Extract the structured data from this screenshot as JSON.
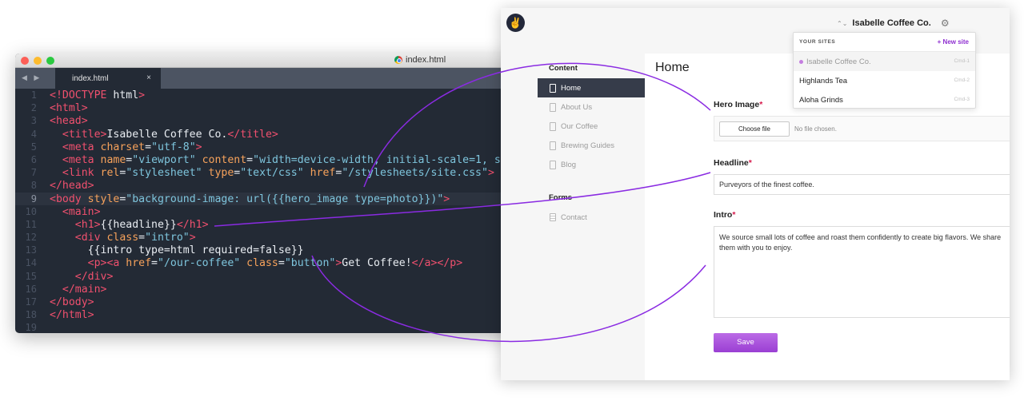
{
  "editor": {
    "window_title": "index.html",
    "tab_label": "index.html",
    "tab_close": "×",
    "nav_arrows": "◀ ▶",
    "lines": [
      {
        "n": "1",
        "segments": [
          {
            "t": "<!DOCTYPE ",
            "c": "tag"
          },
          {
            "t": "html",
            "c": "txt"
          },
          {
            "t": ">",
            "c": "tag"
          }
        ]
      },
      {
        "n": "2",
        "segments": [
          {
            "t": "<html>",
            "c": "tag"
          }
        ]
      },
      {
        "n": "3",
        "segments": [
          {
            "t": "<head>",
            "c": "tag"
          }
        ]
      },
      {
        "n": "4",
        "segments": [
          {
            "t": "  <title>",
            "c": "tag"
          },
          {
            "t": "Isabelle Coffee Co.",
            "c": "txt"
          },
          {
            "t": "</title>",
            "c": "tag"
          }
        ]
      },
      {
        "n": "5",
        "segments": [
          {
            "t": "  <meta ",
            "c": "tag"
          },
          {
            "t": "charset",
            "c": "attr"
          },
          {
            "t": "=",
            "c": "txt"
          },
          {
            "t": "\"utf-8\"",
            "c": "str"
          },
          {
            "t": ">",
            "c": "tag"
          }
        ]
      },
      {
        "n": "6",
        "segments": [
          {
            "t": "  <meta ",
            "c": "tag"
          },
          {
            "t": "name",
            "c": "attr"
          },
          {
            "t": "=",
            "c": "txt"
          },
          {
            "t": "\"viewport\" ",
            "c": "str"
          },
          {
            "t": "content",
            "c": "attr"
          },
          {
            "t": "=",
            "c": "txt"
          },
          {
            "t": "\"width=device-width, initial-scale=1, s",
            "c": "str"
          }
        ]
      },
      {
        "n": "7",
        "segments": [
          {
            "t": "  <link ",
            "c": "tag"
          },
          {
            "t": "rel",
            "c": "attr"
          },
          {
            "t": "=",
            "c": "txt"
          },
          {
            "t": "\"stylesheet\" ",
            "c": "str"
          },
          {
            "t": "type",
            "c": "attr"
          },
          {
            "t": "=",
            "c": "txt"
          },
          {
            "t": "\"text/css\" ",
            "c": "str"
          },
          {
            "t": "href",
            "c": "attr"
          },
          {
            "t": "=",
            "c": "txt"
          },
          {
            "t": "\"/stylesheets/site.css\"",
            "c": "str"
          },
          {
            "t": ">",
            "c": "tag"
          }
        ]
      },
      {
        "n": "8",
        "segments": [
          {
            "t": "</head>",
            "c": "tag"
          }
        ]
      },
      {
        "n": "9",
        "hl": true,
        "segments": [
          {
            "t": "<body ",
            "c": "tag"
          },
          {
            "t": "style",
            "c": "attr"
          },
          {
            "t": "=",
            "c": "txt"
          },
          {
            "t": "\"background-image: url({{hero_image type=photo}})\"",
            "c": "str"
          },
          {
            "t": ">",
            "c": "tag"
          }
        ]
      },
      {
        "n": "10",
        "segments": [
          {
            "t": "  <main>",
            "c": "tag"
          }
        ]
      },
      {
        "n": "11",
        "segments": [
          {
            "t": "    <h1>",
            "c": "tag"
          },
          {
            "t": "{{headline}}",
            "c": "txt"
          },
          {
            "t": "</h1>",
            "c": "tag"
          }
        ]
      },
      {
        "n": "12",
        "segments": [
          {
            "t": "    <div ",
            "c": "tag"
          },
          {
            "t": "class",
            "c": "attr"
          },
          {
            "t": "=",
            "c": "txt"
          },
          {
            "t": "\"intro\"",
            "c": "str"
          },
          {
            "t": ">",
            "c": "tag"
          }
        ]
      },
      {
        "n": "13",
        "segments": [
          {
            "t": "      {{intro type=html required=false}}",
            "c": "txt"
          }
        ]
      },
      {
        "n": "14",
        "segments": [
          {
            "t": "      <p><a ",
            "c": "tag"
          },
          {
            "t": "href",
            "c": "attr"
          },
          {
            "t": "=",
            "c": "txt"
          },
          {
            "t": "\"/our-coffee\" ",
            "c": "str"
          },
          {
            "t": "class",
            "c": "attr"
          },
          {
            "t": "=",
            "c": "txt"
          },
          {
            "t": "\"button\"",
            "c": "str"
          },
          {
            "t": ">",
            "c": "tag"
          },
          {
            "t": "Get Coffee!",
            "c": "txt"
          },
          {
            "t": "</a></p>",
            "c": "tag"
          }
        ]
      },
      {
        "n": "15",
        "segments": [
          {
            "t": "    </div>",
            "c": "tag"
          }
        ]
      },
      {
        "n": "16",
        "segments": [
          {
            "t": "  </main>",
            "c": "tag"
          }
        ]
      },
      {
        "n": "17",
        "segments": [
          {
            "t": "</body>",
            "c": "tag"
          }
        ]
      },
      {
        "n": "18",
        "segments": [
          {
            "t": "</html>",
            "c": "tag"
          }
        ]
      },
      {
        "n": "19",
        "segments": []
      }
    ]
  },
  "cms": {
    "logo_glyph": "✌",
    "site_name": "Isabelle Coffee Co.",
    "site_switch_arrows": "⌃⌄",
    "gear_glyph": "⚙",
    "dropdown": {
      "title": "YOUR SITES",
      "new_site": "+ New site",
      "items": [
        {
          "name": "Isabelle Coffee Co.",
          "shortcut": "Cmd-1",
          "current": true
        },
        {
          "name": "Highlands Tea",
          "shortcut": "Cmd-2",
          "current": false
        },
        {
          "name": "Aloha Grinds",
          "shortcut": "Cmd-3",
          "current": false
        }
      ]
    },
    "sidebar": {
      "content_heading": "Content",
      "content_items": [
        {
          "label": "Home",
          "active": true
        },
        {
          "label": "About Us",
          "active": false
        },
        {
          "label": "Our Coffee",
          "active": false
        },
        {
          "label": "Brewing Guides",
          "active": false
        },
        {
          "label": "Blog",
          "active": false
        }
      ],
      "forms_heading": "Forms",
      "forms_items": [
        {
          "label": "Contact"
        }
      ]
    },
    "main": {
      "page_title": "Home",
      "hero_label": "Hero Image",
      "required_mark": "*",
      "choose_file": "Choose file",
      "no_file": "No file chosen.",
      "headline_label": "Headline",
      "headline_value": "Purveyors of the finest coffee.",
      "intro_label": "Intro",
      "intro_value": "We source small lots of coffee and roast them confidently to create big flavors. We share them with you to enjoy.",
      "save_label": "Save"
    }
  },
  "colors": {
    "connector": "#8a2be2",
    "accent": "#8f2fd1",
    "editor_bg": "#232a35"
  }
}
